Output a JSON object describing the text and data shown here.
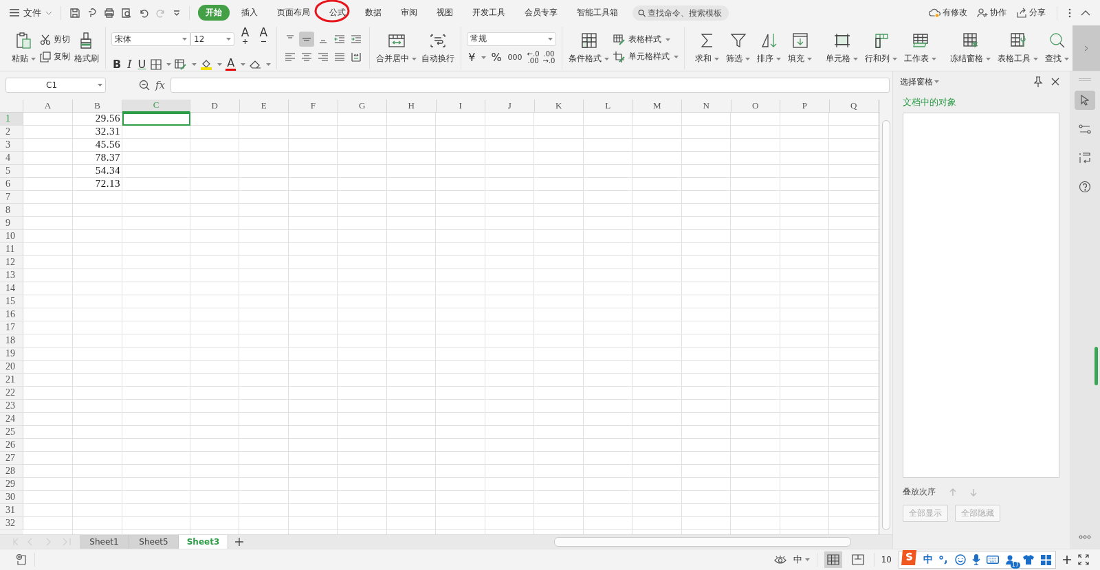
{
  "menu_bar": {
    "file_menu": "文件",
    "tabs": [
      {
        "label": "开始",
        "selected": true,
        "circled": false
      },
      {
        "label": "插入",
        "selected": false,
        "circled": false
      },
      {
        "label": "页面布局",
        "selected": false,
        "circled": false
      },
      {
        "label": "公式",
        "selected": false,
        "circled": true
      },
      {
        "label": "数据",
        "selected": false,
        "circled": false
      },
      {
        "label": "审阅",
        "selected": false,
        "circled": false
      },
      {
        "label": "视图",
        "selected": false,
        "circled": false
      },
      {
        "label": "开发工具",
        "selected": false,
        "circled": false
      },
      {
        "label": "会员专享",
        "selected": false,
        "circled": false
      },
      {
        "label": "智能工具箱",
        "selected": false,
        "circled": false
      }
    ],
    "search": {
      "placeholder": "查找命令、搜索模板"
    },
    "actions": [
      "有修改",
      "协作",
      "分享"
    ]
  },
  "ribbon": {
    "paste": {
      "label": "粘贴",
      "dropdown": true
    },
    "cut": "剪切",
    "copy": "复制",
    "format_painter": "格式刷",
    "font_name": "宋体",
    "font_size": "12",
    "grow_font": "A",
    "shrink_font": "A",
    "style_buttons": [
      "B",
      "I",
      "U"
    ],
    "font_color": "A",
    "alignment": [
      {
        "selected": false
      },
      {
        "selected": true
      },
      {
        "selected": false
      },
      {
        "selected": false
      },
      {
        "selected": false
      },
      {
        "selected": false
      },
      {
        "selected": false
      },
      {
        "selected": false
      },
      {
        "selected": false
      },
      {
        "selected": false
      }
    ],
    "wrap": [
      {
        "label": "合并居中",
        "dropdown": true
      },
      {
        "label": "自动换行",
        "dropdown": false
      }
    ],
    "number_format": "常规",
    "currency": "¥",
    "percent": "%",
    "thousands": "000",
    "decimals": [
      {
        "top": "←.0",
        "bottom": ".00"
      },
      {
        "top": ".00",
        "bottom": "→.0"
      }
    ],
    "conditional_format": {
      "label": "条件格式",
      "dropdown": true
    },
    "styles": [
      {
        "label": "表格样式",
        "dropdown": true
      },
      {
        "label": "单元格样式",
        "dropdown": true
      }
    ],
    "tools": [
      {
        "label": "求和",
        "dropdown": true
      },
      {
        "label": "筛选",
        "dropdown": true
      },
      {
        "label": "排序",
        "dropdown": true
      },
      {
        "label": "填充",
        "dropdown": true
      },
      {
        "label": "单元格",
        "dropdown": true
      },
      {
        "label": "行和列",
        "dropdown": true
      },
      {
        "label": "工作表",
        "dropdown": true
      },
      {
        "label": "冻结窗格",
        "dropdown": true
      },
      {
        "label": "表格工具",
        "dropdown": true
      },
      {
        "label": "查找",
        "dropdown": true
      }
    ]
  },
  "formula_bar": {
    "name_box": "C1",
    "function_label": "fx"
  },
  "columns": [
    {
      "label": "A",
      "selected": false
    },
    {
      "label": "B",
      "selected": false,
      "cells": [
        "29.56",
        "32.31",
        "45.56",
        "78.37",
        "54.34",
        "72.13"
      ]
    },
    {
      "label": "C",
      "selected": true
    },
    {
      "label": "D",
      "selected": false
    },
    {
      "label": "E",
      "selected": false
    },
    {
      "label": "F",
      "selected": false
    },
    {
      "label": "G",
      "selected": false
    },
    {
      "label": "H",
      "selected": false
    },
    {
      "label": "I",
      "selected": false
    },
    {
      "label": "J",
      "selected": false
    },
    {
      "label": "K",
      "selected": false
    },
    {
      "label": "L",
      "selected": false
    },
    {
      "label": "M",
      "selected": false
    },
    {
      "label": "N",
      "selected": false
    },
    {
      "label": "O",
      "selected": false
    },
    {
      "label": "P",
      "selected": false
    },
    {
      "label": "Q",
      "selected": false
    }
  ],
  "rows": [
    {
      "label": "1",
      "selected": true
    },
    {
      "label": "2",
      "selected": false
    },
    {
      "label": "3",
      "selected": false
    },
    {
      "label": "4",
      "selected": false
    },
    {
      "label": "5",
      "selected": false
    },
    {
      "label": "6",
      "selected": false
    },
    {
      "label": "7",
      "selected": false
    },
    {
      "label": "8",
      "selected": false
    },
    {
      "label": "9",
      "selected": false
    },
    {
      "label": "10",
      "selected": false
    },
    {
      "label": "11",
      "selected": false
    },
    {
      "label": "12",
      "selected": false
    },
    {
      "label": "13",
      "selected": false
    },
    {
      "label": "14",
      "selected": false
    },
    {
      "label": "15",
      "selected": false
    },
    {
      "label": "16",
      "selected": false
    },
    {
      "label": "17",
      "selected": false
    },
    {
      "label": "18",
      "selected": false
    },
    {
      "label": "19",
      "selected": false
    },
    {
      "label": "20",
      "selected": false
    },
    {
      "label": "21",
      "selected": false
    },
    {
      "label": "22",
      "selected": false
    },
    {
      "label": "23",
      "selected": false
    },
    {
      "label": "24",
      "selected": false
    },
    {
      "label": "25",
      "selected": false
    },
    {
      "label": "26",
      "selected": false
    },
    {
      "label": "27",
      "selected": false
    },
    {
      "label": "28",
      "selected": false
    },
    {
      "label": "29",
      "selected": false
    },
    {
      "label": "30",
      "selected": false
    },
    {
      "label": "31",
      "selected": false
    },
    {
      "label": "32",
      "selected": false
    }
  ],
  "sheet_tabs": [
    {
      "label": "Sheet1",
      "selected": false
    },
    {
      "label": "Sheet5",
      "selected": false
    },
    {
      "label": "Sheet3",
      "selected": true
    }
  ],
  "selection_pane": {
    "title": "选择窗格",
    "heading": "文档中的对象",
    "order_label": "叠放次序",
    "buttons": [
      {
        "label": "全部显示",
        "disabled": true
      },
      {
        "label": "全部隐藏",
        "disabled": true
      }
    ]
  },
  "side_rail": [
    {
      "selected": true
    },
    {
      "selected": false
    },
    {
      "selected": false
    },
    {
      "selected": false
    }
  ],
  "status_bar": {
    "input_mode": "中",
    "zoom": "10",
    "views": [
      {
        "selected": true
      },
      {
        "selected": false
      }
    ]
  },
  "ime_bar": {
    "language": "中",
    "badge": "17"
  }
}
